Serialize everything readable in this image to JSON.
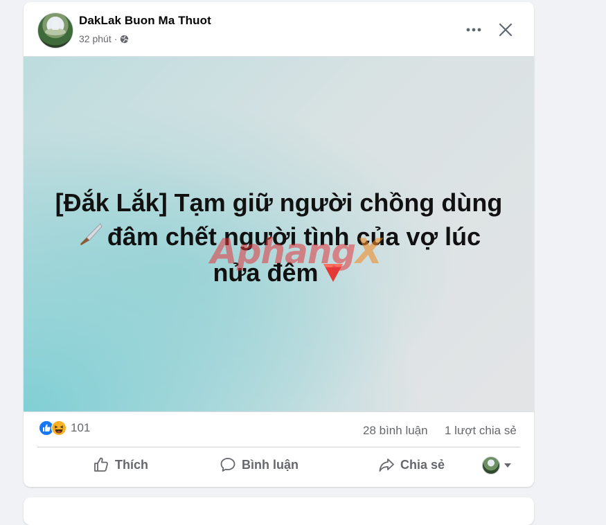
{
  "post": {
    "page_name": "DakLak Buon Ma Thuot",
    "time": "32 phút",
    "separator": "·",
    "privacy_icon": "globe-icon",
    "image_text": {
      "line1": "[Đắk Lắk] Tạm giữ người chồng dùng",
      "line2": "đâm chết người tình của vợ lúc",
      "line3": "nửa đêm"
    },
    "watermark": {
      "main": "Aphang",
      "suffix": "X"
    },
    "reactions": {
      "count": "101",
      "icons": [
        "like-icon",
        "haha-icon"
      ]
    },
    "comments": "28 bình luận",
    "shares": "1 lượt chia sẻ"
  },
  "actions": {
    "like": "Thích",
    "comment": "Bình luận",
    "share": "Chia sẻ"
  },
  "colors": {
    "card_bg": "#ffffff",
    "page_bg": "#f0f2f5",
    "muted_text": "#65676b",
    "like_blue": "#1877f2",
    "haha_yellow": "#f7b125"
  }
}
